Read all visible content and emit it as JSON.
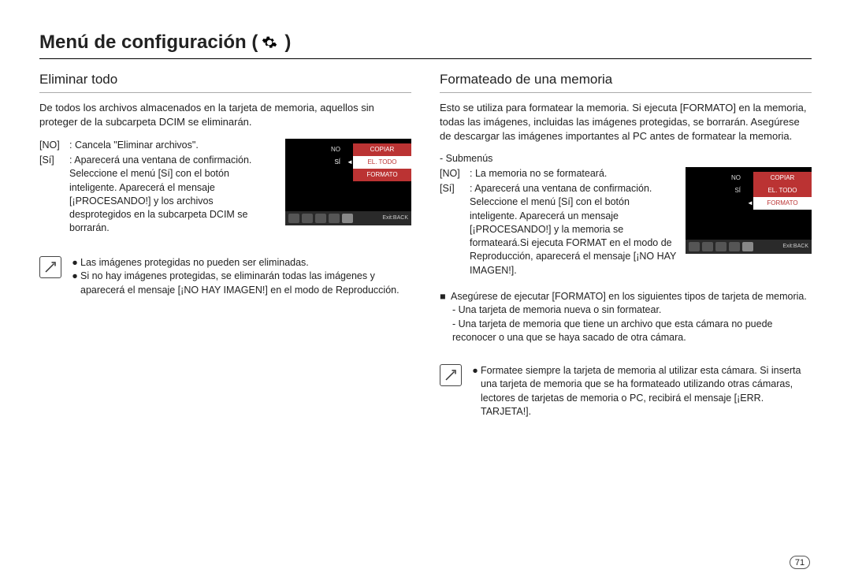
{
  "title": {
    "prefix": "Menú de configuración ( ",
    "icon_name": "gear-icon",
    "suffix": " )"
  },
  "left": {
    "heading": "Eliminar todo",
    "intro": "De todos los archivos almacenados en la tarjeta de memoria, aquellos sin proteger de la subcarpeta DCIM se eliminarán.",
    "opts": {
      "no_label": "[NO]",
      "no_desc": ": Cancela \"Eliminar archivos\".",
      "si_label": "[Sí]",
      "si_desc": ": Aparecerá una ventana de confirmación. Seleccione el menú [Sí] con el botón inteligente. Aparecerá el mensaje [¡PROCESANDO!] y los archivos desprotegidos en la subcarpeta DCIM se borrarán."
    },
    "lcd": {
      "rows": [
        {
          "left": "NO",
          "right": "COPIAR",
          "selected": false
        },
        {
          "left": "SÍ",
          "right": "EL. TODO",
          "selected": true
        },
        {
          "left": "",
          "right": "FORMATO",
          "selected": false
        }
      ],
      "exit": "Exit:BACK"
    },
    "note": {
      "b1": "Las imágenes protegidas no pueden ser eliminadas.",
      "b2": "Si no hay imágenes protegidas, se eliminarán todas las imágenes y aparecerá el mensaje [¡NO HAY IMAGEN!] en el modo de Reproducción."
    }
  },
  "right": {
    "heading": "Formateado de una memoria",
    "intro": "Esto se utiliza para formatear la memoria. Si ejecuta [FORMATO] en la memoria, todas las imágenes, incluidas las imágenes protegidas, se borrarán. Asegúrese de descargar las imágenes importantes al PC antes de formatear la memoria.",
    "sub_label": "- Submenús",
    "opts": {
      "no_label": "[NO]",
      "no_desc": ": La memoria no se formateará.",
      "si_label": "[Sí]",
      "si_desc": ": Aparecerá una ventana de confirmación. Seleccione el menú [Sí] con el botón inteligente. Aparecerá un mensaje [¡PROCESANDO!] y la memoria se formateará.Si ejecuta FORMAT en el modo de Reproducción, aparecerá el mensaje [¡NO HAY IMAGEN!]."
    },
    "lcd": {
      "rows": [
        {
          "left": "NO",
          "right": "COPIAR",
          "selected": false
        },
        {
          "left": "SÍ",
          "right": "EL. TODO",
          "selected": false
        },
        {
          "left": "",
          "right": "FORMATO",
          "selected": true
        }
      ],
      "exit": "Exit:BACK"
    },
    "ensure_line": "Asegúrese de ejecutar [FORMATO] en los siguientes tipos de tarjeta de memoria.",
    "ensure_items": {
      "i1": "- Una tarjeta de memoria nueva o sin formatear.",
      "i2": "- Una tarjeta de memoria que tiene un archivo que esta cámara no puede reconocer o una que se haya sacado de otra cámara."
    },
    "note": {
      "b1": "Formatee siempre la tarjeta de memoria al utilizar esta cámara. Si inserta una tarjeta de memoria que se ha formateado utilizando otras cámaras, lectores de tarjetas de memoria o PC, recibirá el mensaje [¡ERR. TARJETA!]."
    }
  },
  "page_number": "71",
  "icons": {
    "gear": "gear-icon",
    "tip": "tip-icon"
  }
}
